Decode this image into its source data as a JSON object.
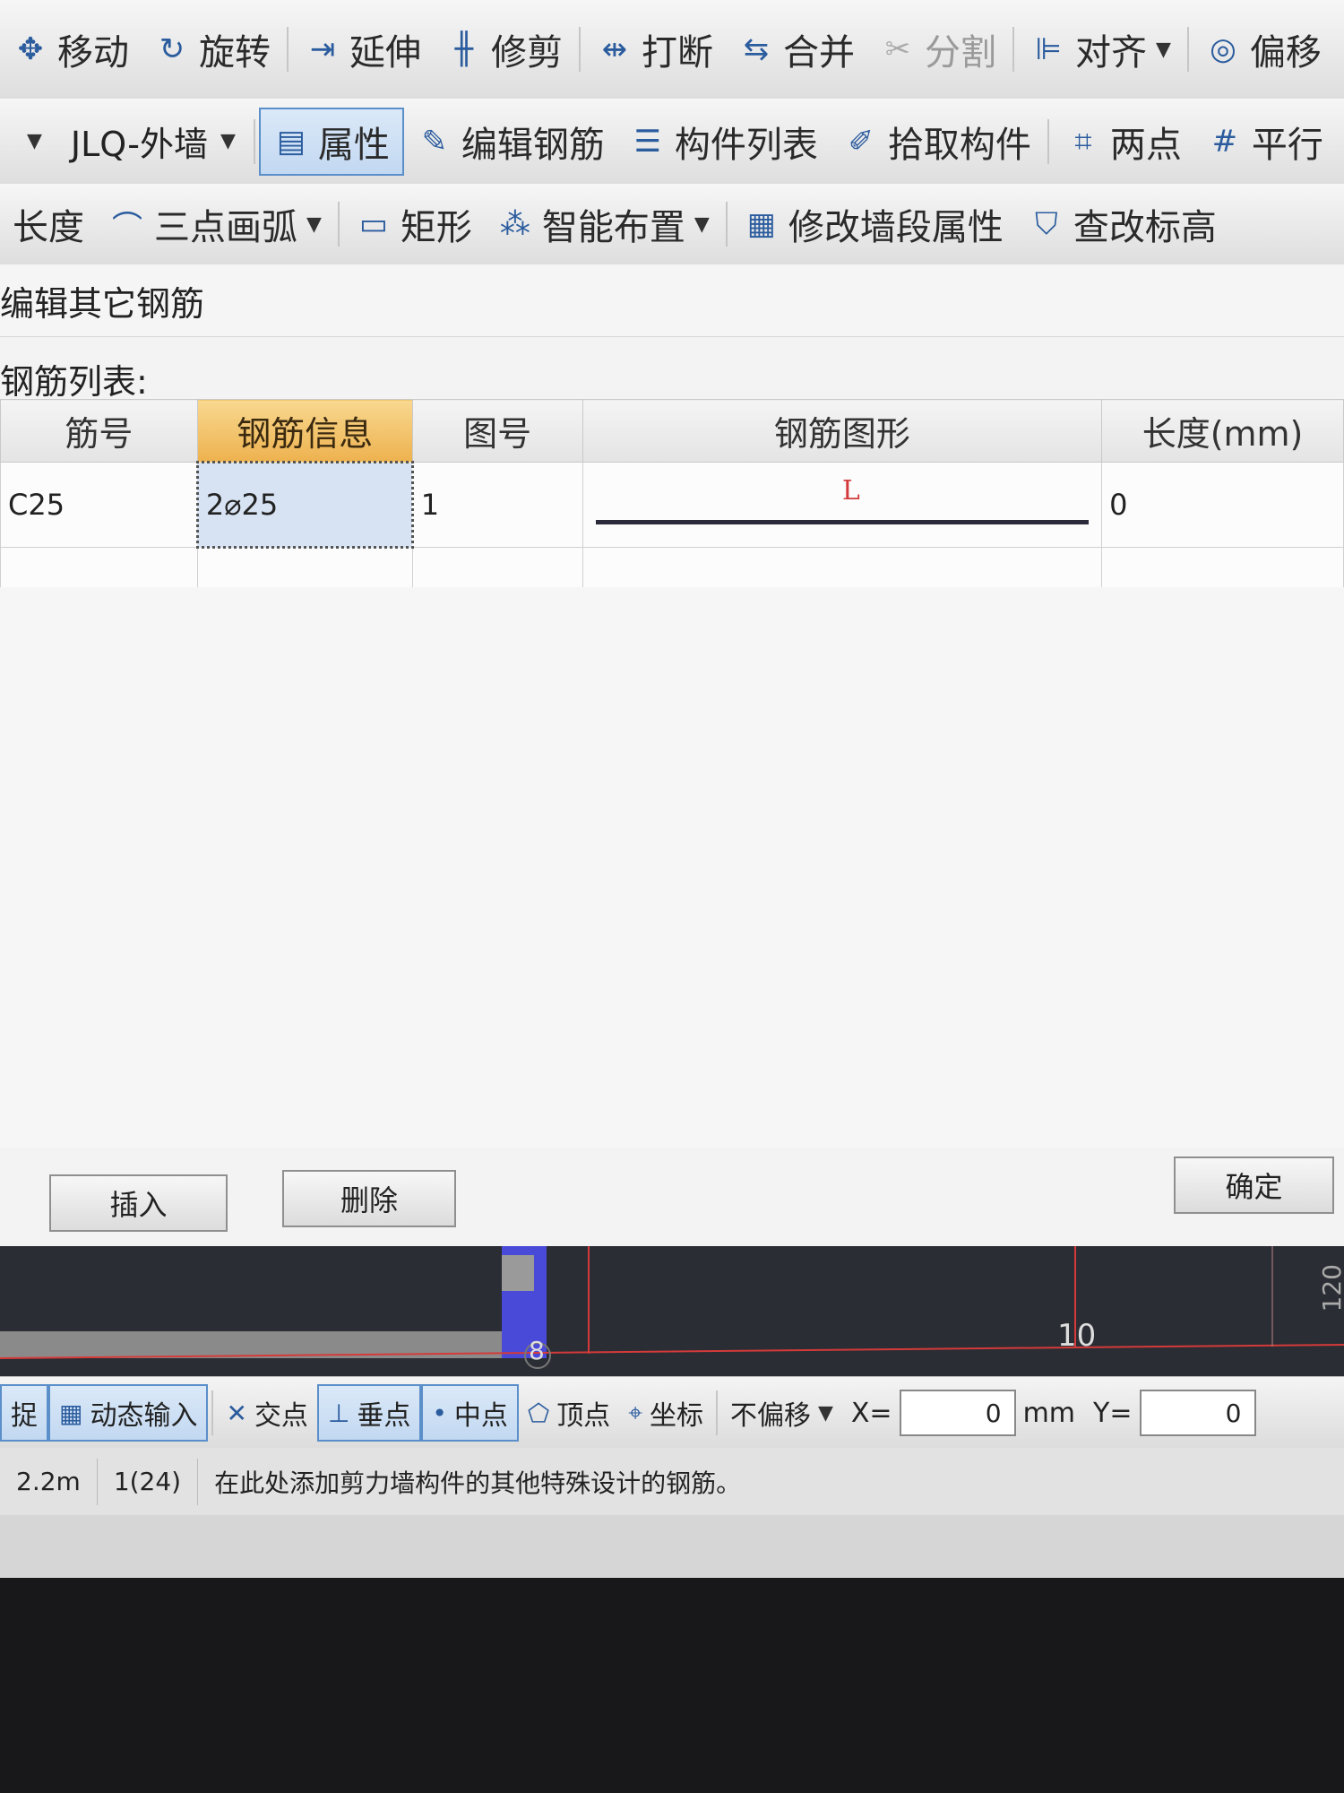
{
  "toolbar_row1": [
    {
      "icon": "move-icon",
      "glyph": "✥",
      "label": "移动"
    },
    {
      "icon": "rotate-icon",
      "glyph": "↻",
      "label": "旋转"
    },
    {
      "icon": "extend-icon",
      "glyph": "⇥",
      "label": "延伸"
    },
    {
      "icon": "trim-icon",
      "glyph": "╫",
      "label": "修剪"
    },
    {
      "icon": "break-icon",
      "glyph": "⇹",
      "label": "打断"
    },
    {
      "icon": "merge-icon",
      "glyph": "⇆",
      "label": "合并"
    },
    {
      "icon": "split-icon",
      "glyph": "✂",
      "label": "分割",
      "disabled": true
    },
    {
      "icon": "align-icon",
      "glyph": "⊫",
      "label": "对齐",
      "dropdown": true
    },
    {
      "icon": "offset-icon",
      "glyph": "◎",
      "label": "偏移"
    }
  ],
  "toolbar_row2": {
    "floor_select": "",
    "component_select": "JLQ-外墙",
    "items": [
      {
        "icon": "properties-icon",
        "glyph": "▤",
        "label": "属性",
        "active": true
      },
      {
        "icon": "edit-rebar-icon",
        "glyph": "✎",
        "label": "编辑钢筋"
      },
      {
        "icon": "component-list-icon",
        "glyph": "☰",
        "label": "构件列表"
      },
      {
        "icon": "pick-component-icon",
        "glyph": "✐",
        "label": "拾取构件"
      },
      {
        "icon": "two-points-icon",
        "glyph": "⌗",
        "label": "两点"
      },
      {
        "icon": "parallel-icon",
        "glyph": "#",
        "label": "平行"
      }
    ]
  },
  "toolbar_row3": [
    {
      "icon": "",
      "glyph": "",
      "label": "长度"
    },
    {
      "icon": "three-point-arc-icon",
      "glyph": "⌒",
      "label": "三点画弧",
      "dropdown": true
    },
    {
      "icon": "rectangle-icon",
      "glyph": "▭",
      "label": "矩形"
    },
    {
      "icon": "smart-layout-icon",
      "glyph": "⁂",
      "label": "智能布置",
      "dropdown": true
    },
    {
      "icon": "modify-wall-icon",
      "glyph": "▦",
      "label": "修改墙段属性"
    },
    {
      "icon": "check-elevation-icon",
      "glyph": "⛉",
      "label": "查改标高"
    }
  ],
  "dialog": {
    "title": "编辑其它钢筋",
    "list_label": "钢筋列表:",
    "columns": [
      "筋号",
      "钢筋信息",
      "图号",
      "钢筋图形",
      "长度(mm)"
    ],
    "rows": [
      {
        "bar_no": "C25",
        "info": "2⌀25",
        "figure_no": "1",
        "shape_label": "L",
        "length": "0"
      }
    ],
    "insert_button": "插入",
    "delete_button": "删除",
    "ok_button": "确定"
  },
  "cad": {
    "axis_left": "8",
    "axis_right": "10",
    "axis_edge": "120"
  },
  "statusbar": {
    "items": [
      {
        "icon": "",
        "label": "捉",
        "on": true
      },
      {
        "icon": "dynamic-input-icon",
        "glyph": "▦",
        "label": "动态输入",
        "on": true
      },
      {
        "icon": "intersection-icon",
        "glyph": "✕",
        "label": "交点",
        "on": false
      },
      {
        "icon": "perpendicular-icon",
        "glyph": "⊥",
        "label": "垂点",
        "on": true
      },
      {
        "icon": "midpoint-icon",
        "glyph": "•",
        "label": "中点",
        "on": true
      },
      {
        "icon": "vertex-icon",
        "glyph": "⬠",
        "label": "顶点",
        "on": false
      },
      {
        "icon": "coordinate-icon",
        "glyph": "⌖",
        "label": "坐标",
        "on": false
      }
    ],
    "offset_mode": "不偏移",
    "x_label": "X=",
    "x_value": "0",
    "unit": "mm",
    "y_label": "Y=",
    "y_value": "0"
  },
  "infobar": {
    "height": "2.2m",
    "count": "1(24)",
    "hint": "在此处添加剪力墙构件的其他特殊设计的钢筋。"
  }
}
